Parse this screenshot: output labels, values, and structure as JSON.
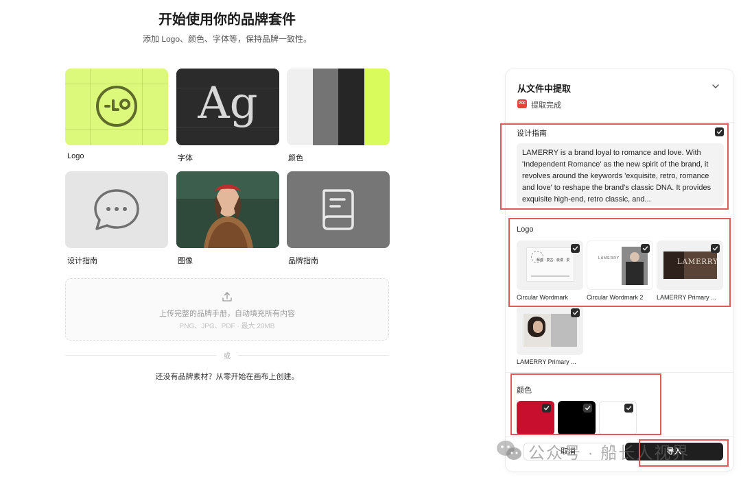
{
  "header": {
    "title": "开始使用你的品牌套件",
    "subtitle": "添加 Logo、颜色、字体等，保持品牌一致性。"
  },
  "cards": [
    {
      "label": "Logo",
      "icon": "logo-mark-icon"
    },
    {
      "label": "字体",
      "preview_text": "Ag"
    },
    {
      "label": "颜色",
      "stripes": [
        "#efefef",
        "#747474",
        "#262626",
        "#d9fb5b"
      ]
    },
    {
      "label": "设计指南",
      "icon": "chat-bubble-icon"
    },
    {
      "label": "图像",
      "icon": "portrait-image"
    },
    {
      "label": "品牌指南",
      "icon": "book-icon"
    }
  ],
  "upload": {
    "text": "上传完整的品牌手册，自动填充所有内容",
    "formats": "PNG、JPG、PDF · 最大 20MB"
  },
  "divider_text": "或",
  "scratch_link": "还没有品牌素材？从零开始在画布上创建。",
  "panel": {
    "title": "从文件中提取",
    "file_badge": "PDF",
    "status": "提取完成",
    "guide": {
      "label": "设计指南",
      "text": "LAMERRY is a brand loyal to romance and love. With 'Independent Romance' as the new spirit of the brand, it revolves around the keywords 'exquisite, retro, romance and love' to reshape the brand's classic DNA. It provides exquisite high-end, retro classic, and..."
    },
    "logo_section": {
      "label": "Logo",
      "items": [
        {
          "caption": "Circular Wordmark",
          "mark": "辉煌 · 复古 · 浪漫 · 爱"
        },
        {
          "caption": "Circular Wordmark 2",
          "mark": "LAMERRY"
        },
        {
          "caption": "LAMERRY Primary ...",
          "mark": "LAMERRY"
        },
        {
          "caption": "LAMERRY Primary ..."
        }
      ]
    },
    "color_section": {
      "label": "颜色",
      "swatches": [
        "#c8102e",
        "#000000",
        "#ffffff"
      ]
    },
    "cancel_label": "取消",
    "import_label": "导入"
  },
  "watermark": {
    "text": "公众号 · 船长人视界"
  },
  "colors": {
    "highlight": "#e05a5a",
    "accent_green": "#dcf97c"
  }
}
